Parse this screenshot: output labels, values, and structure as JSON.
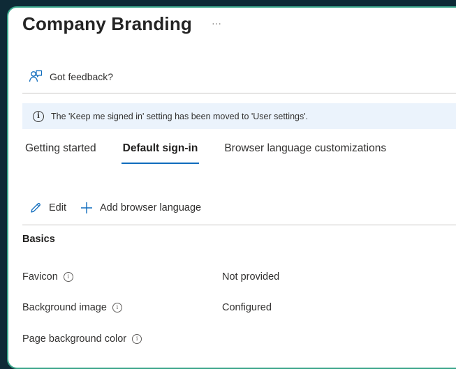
{
  "page": {
    "title": "Company Branding",
    "more_label": "···"
  },
  "feedback": {
    "label": "Got feedback?"
  },
  "info_banner": {
    "icon_glyph": "i",
    "text": "The 'Keep me signed in' setting has been moved to 'User settings'."
  },
  "tabs": [
    {
      "label": "Getting started",
      "active": false
    },
    {
      "label": "Default sign-in",
      "active": true
    },
    {
      "label": "Browser language customizations",
      "active": false
    }
  ],
  "toolbar": {
    "edit_label": "Edit",
    "add_language_label": "Add browser language"
  },
  "section": {
    "title": "Basics"
  },
  "properties": [
    {
      "label": "Favicon",
      "value": "Not provided"
    },
    {
      "label": "Background image",
      "value": "Configured"
    },
    {
      "label": "Page background color",
      "value": ""
    }
  ],
  "colors": {
    "accent": "#0f6cbd",
    "frame_border": "#3aa58a",
    "info_bar_bg": "#ebf3fc",
    "backdrop": "#0e2a36"
  }
}
